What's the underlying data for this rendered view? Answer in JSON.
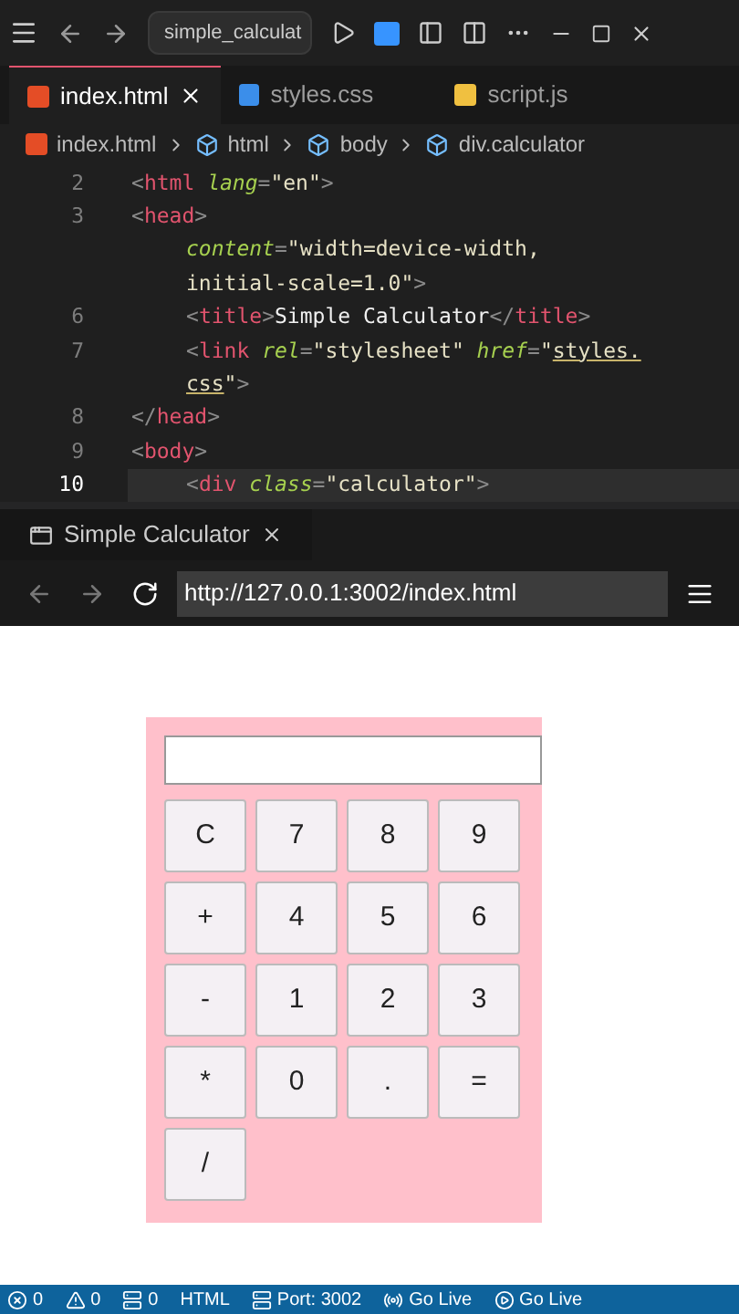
{
  "title_bar": {
    "search": "simple_calculat"
  },
  "editor_tabs": [
    {
      "label": "index.html",
      "kind": "html",
      "selected": true
    },
    {
      "label": "styles.css",
      "kind": "css",
      "selected": false
    },
    {
      "label": "script.js",
      "kind": "js",
      "selected": false
    }
  ],
  "breadcrumb": [
    {
      "label": "index.html",
      "kind": "html"
    },
    {
      "label": "html",
      "kind": "element"
    },
    {
      "label": "body",
      "kind": "element"
    },
    {
      "label": "div.calculator",
      "kind": "element"
    }
  ],
  "code_lines": [
    {
      "number": "2",
      "current": false,
      "indented": false,
      "tokens": [
        {
          "kind": "punct",
          "text": "<"
        },
        {
          "kind": "tag",
          "text": "html"
        },
        {
          "kind": "attr",
          "text": "lang"
        },
        {
          "kind": "punct",
          "text": "="
        },
        {
          "kind": "str",
          "text": "\"en\""
        },
        {
          "kind": "punct",
          "text": ">"
        }
      ]
    },
    {
      "number": "3",
      "current": false,
      "indented": false,
      "tokens": [
        {
          "kind": "punct",
          "text": "<"
        },
        {
          "kind": "tag",
          "text": "head"
        },
        {
          "kind": "punct",
          "text": ">"
        }
      ]
    },
    {
      "current": false,
      "indented": true,
      "tokens": [
        {
          "kind": "attr",
          "text": "content"
        },
        {
          "kind": "punct",
          "text": "="
        },
        {
          "kind": "str",
          "text": "\"width=device-width,"
        }
      ]
    },
    {
      "current": false,
      "indented": true,
      "tokens": [
        {
          "kind": "str",
          "text": "initial-scale=1.0\""
        },
        {
          "kind": "punct",
          "text": ">"
        }
      ]
    },
    {
      "number": "6",
      "current": false,
      "indented": true,
      "tokens": [
        {
          "kind": "punct",
          "text": "<"
        },
        {
          "kind": "tag",
          "text": "title"
        },
        {
          "kind": "punct",
          "text": ">"
        },
        {
          "kind": "text",
          "text": "Simple Calculator"
        },
        {
          "kind": "punct",
          "text": "</"
        },
        {
          "kind": "tag",
          "text": "title"
        },
        {
          "kind": "punct",
          "text": ">"
        }
      ]
    },
    {
      "number": "7",
      "current": false,
      "indented": true,
      "tokens": [
        {
          "kind": "punct",
          "text": "<"
        },
        {
          "kind": "tag",
          "text": "link"
        },
        {
          "kind": "attr",
          "text": "rel"
        },
        {
          "kind": "punct",
          "text": "="
        },
        {
          "kind": "str",
          "text": "\"stylesheet\""
        },
        {
          "kind": "attr",
          "text": "href"
        },
        {
          "kind": "punct",
          "text": "="
        },
        {
          "kind": "str",
          "text": "\""
        },
        {
          "kind": "link",
          "text": "styles."
        }
      ]
    },
    {
      "current": false,
      "indented": true,
      "tokens": [
        {
          "kind": "link",
          "text": "css"
        },
        {
          "kind": "str",
          "text": "\""
        },
        {
          "kind": "punct",
          "text": ">"
        }
      ]
    },
    {
      "number": "8",
      "current": false,
      "indented": false,
      "tokens": [
        {
          "kind": "punct",
          "text": "</"
        },
        {
          "kind": "tag",
          "text": "head"
        },
        {
          "kind": "punct",
          "text": ">"
        }
      ]
    },
    {
      "number": "9",
      "current": false,
      "indented": false,
      "tokens": [
        {
          "kind": "punct",
          "text": "<"
        },
        {
          "kind": "tag",
          "text": "body"
        },
        {
          "kind": "punct",
          "text": ">"
        }
      ]
    },
    {
      "number": "10",
      "current": true,
      "indented": true,
      "tokens": [
        {
          "kind": "punct",
          "text": "<"
        },
        {
          "kind": "tag",
          "text": "div"
        },
        {
          "kind": "attr",
          "text": "class"
        },
        {
          "kind": "punct",
          "text": "="
        },
        {
          "kind": "str",
          "text": "\"calculator\""
        },
        {
          "kind": "punct",
          "text": ">"
        }
      ]
    }
  ],
  "preview_tab": {
    "label": "Simple Calculator"
  },
  "address": "http://127.0.0.1:3002/index.html",
  "calculator": {
    "keys": [
      "C",
      "7",
      "8",
      "9",
      "+",
      "4",
      "5",
      "6",
      "-",
      "1",
      "2",
      "3",
      "*",
      "0",
      ".",
      "=",
      "/"
    ]
  },
  "status_bar": [
    {
      "kind": "errors",
      "text": "0"
    },
    {
      "kind": "warnings",
      "text": "0"
    },
    {
      "kind": "ports",
      "text": "0"
    },
    {
      "kind": "plain",
      "text": "HTML"
    },
    {
      "kind": "ports",
      "text": "Port: 3002"
    },
    {
      "kind": "live",
      "text": "Go Live"
    },
    {
      "kind": "play",
      "text": "Go Live"
    }
  ]
}
